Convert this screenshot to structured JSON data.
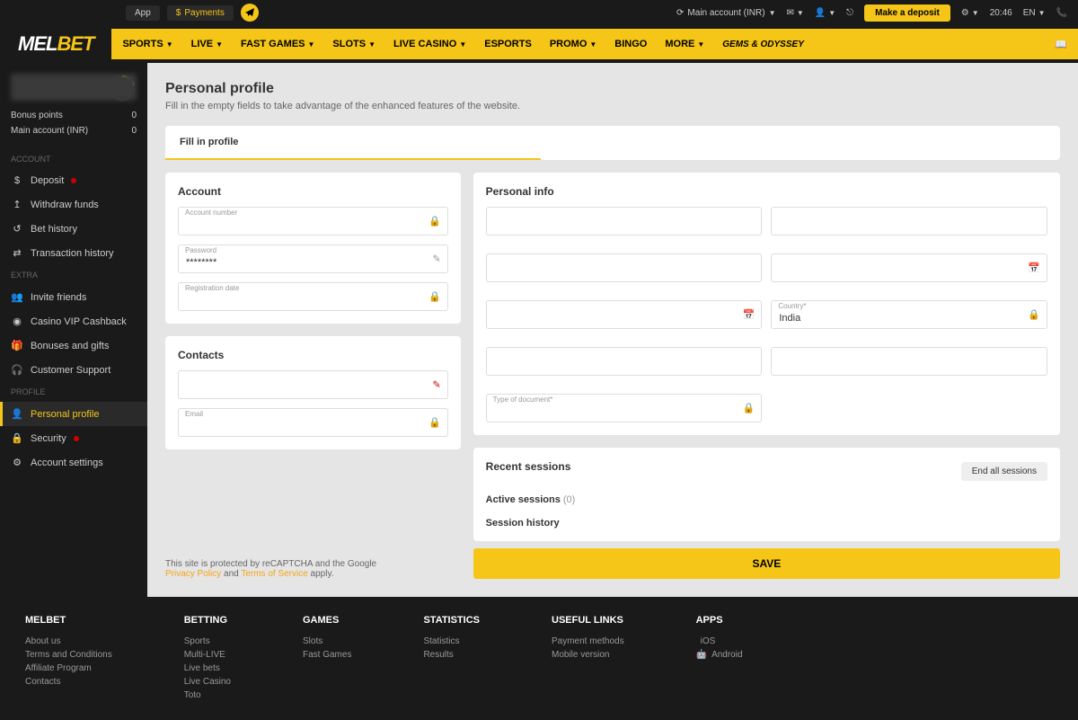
{
  "topbar": {
    "app": "App",
    "payments": "Payments",
    "account": "Main account (INR)",
    "deposit": "Make a deposit",
    "time": "20:46",
    "lang": "EN"
  },
  "logo": {
    "mel": "MEL",
    "bet": "BET"
  },
  "nav": {
    "items": [
      "SPORTS",
      "LIVE",
      "FAST GAMES",
      "SLOTS",
      "LIVE CASINO",
      "ESPORTS",
      "PROMO",
      "BINGO",
      "MORE"
    ],
    "gems": "GEMS & ODYSSEY"
  },
  "sidebar": {
    "progress": "1/5",
    "bonus_label": "Bonus points",
    "bonus_val": "0",
    "main_label": "Main account (INR)",
    "main_val": "0",
    "section_account": "ACCOUNT",
    "deposit": "Deposit",
    "withdraw": "Withdraw funds",
    "bethistory": "Bet history",
    "transhistory": "Transaction history",
    "section_extra": "EXTRA",
    "invite": "Invite friends",
    "cashback": "Casino VIP Cashback",
    "bonuses": "Bonuses and gifts",
    "support": "Customer Support",
    "section_profile": "PROFILE",
    "personal": "Personal profile",
    "security": "Security",
    "settings": "Account settings"
  },
  "page": {
    "title": "Personal profile",
    "subtitle": "Fill in the empty fields to take advantage of the enhanced features of the website.",
    "tab": "Fill in profile"
  },
  "account": {
    "title": "Account",
    "accnum_label": "Account number",
    "password_label": "Password",
    "password_value": "********",
    "regdate_label": "Registration date"
  },
  "contacts": {
    "title": "Contacts",
    "email_label": "Email"
  },
  "personal": {
    "title": "Personal info",
    "country_label": "Country*",
    "country_value": "India",
    "doctype_label": "Type of document*"
  },
  "sessions": {
    "title": "Recent sessions",
    "end_btn": "End all sessions",
    "active": "Active sessions",
    "active_count": "(0)",
    "history": "Session history"
  },
  "captcha": {
    "line1": "This site is protected by reCAPTCHA and the Google",
    "privacy": "Privacy Policy",
    "and": " and ",
    "terms": "Terms of Service",
    "apply": " apply."
  },
  "save": "SAVE",
  "footer": {
    "c1": {
      "title": "MELBET",
      "links": [
        "About us",
        "Terms and Conditions",
        "Affiliate Program",
        "Contacts"
      ]
    },
    "c2": {
      "title": "BETTING",
      "links": [
        "Sports",
        "Multi-LIVE",
        "Live bets",
        "Live Casino",
        "Toto"
      ]
    },
    "c3": {
      "title": "GAMES",
      "links": [
        "Slots",
        "Fast Games"
      ]
    },
    "c4": {
      "title": "STATISTICS",
      "links": [
        "Statistics",
        "Results"
      ]
    },
    "c5": {
      "title": "USEFUL LINKS",
      "links": [
        "Payment methods",
        "Mobile version"
      ]
    },
    "c6": {
      "title": "APPS",
      "ios": "iOS",
      "android": "Android"
    }
  }
}
